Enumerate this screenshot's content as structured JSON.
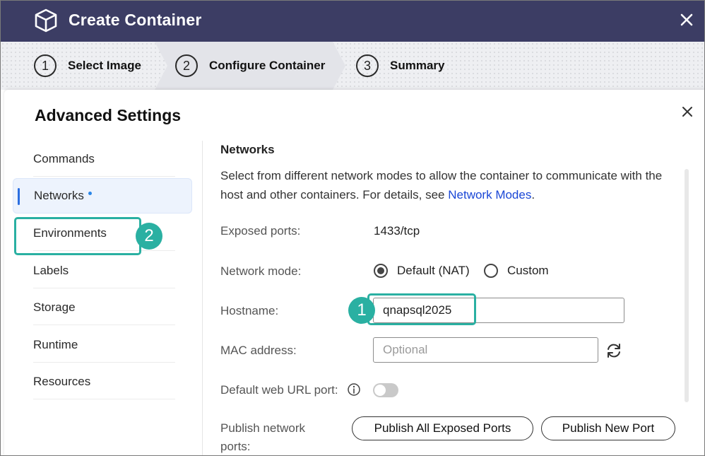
{
  "window": {
    "title": "Create Container"
  },
  "stepper": {
    "steps": [
      {
        "number": "1",
        "label": "Select Image"
      },
      {
        "number": "2",
        "label": "Configure Container"
      },
      {
        "number": "3",
        "label": "Summary"
      }
    ],
    "active_step": 2
  },
  "dialog": {
    "title": "Advanced Settings"
  },
  "sidebar": {
    "items": [
      {
        "label": "Commands"
      },
      {
        "label": "Networks"
      },
      {
        "label": "Environments"
      },
      {
        "label": "Labels"
      },
      {
        "label": "Storage"
      },
      {
        "label": "Runtime"
      },
      {
        "label": "Resources"
      }
    ],
    "active_item": "Networks"
  },
  "networks": {
    "section_title": "Networks",
    "description": "Select from different network modes to allow the container to communicate with the host and other containers. For details, see ",
    "description_link": "Network Modes",
    "description_end": ".",
    "exposed_ports_label": "Exposed ports:",
    "exposed_ports_value": "1433/tcp",
    "network_mode_label": "Network mode:",
    "network_mode_options": [
      "Default (NAT)",
      "Custom"
    ],
    "network_mode_selected": "Default (NAT)",
    "hostname_label": "Hostname:",
    "hostname_value": "qnapsql2025",
    "mac_label": "MAC address:",
    "mac_placeholder": "Optional",
    "web_port_label": "Default web URL port:",
    "web_port_enabled": false,
    "publish_label_line1": "Publish network",
    "publish_label_line2": "ports:",
    "publish_all_button": "Publish All Exposed Ports",
    "publish_new_button": "Publish New Port"
  },
  "annotations": {
    "badge_1": "1",
    "badge_2": "2"
  },
  "colors": {
    "titlebar": "#3c3d64",
    "accent_blue": "#2b6ee0",
    "link": "#1a47d6",
    "annotation": "#2ab0a2"
  }
}
